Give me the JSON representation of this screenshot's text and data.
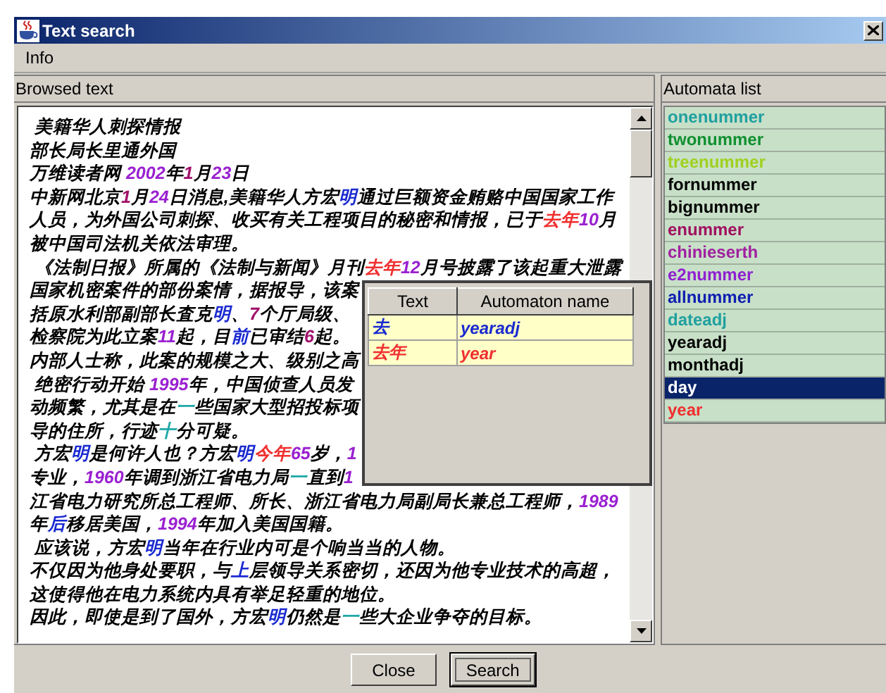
{
  "window": {
    "title": "Text search"
  },
  "menu": [
    "Info"
  ],
  "browsed_text": {
    "label": "Browsed text",
    "lines": [
      [
        {
          "text": " 美籍华人刺探情报"
        }
      ],
      [
        {
          "text": "部长局长里通外国"
        }
      ],
      [
        {
          "text": "万维读者网 "
        },
        {
          "text": "2002",
          "color": "#9a20d0"
        },
        {
          "text": "年"
        },
        {
          "text": "1",
          "color": "#a0106a"
        },
        {
          "text": "月"
        },
        {
          "text": "23",
          "color": "#9a20d0"
        },
        {
          "text": "日"
        }
      ],
      [
        {
          "text": "中新网北京"
        },
        {
          "text": "1",
          "color": "#a0106a"
        },
        {
          "text": "月"
        },
        {
          "text": "24",
          "color": "#9a20d0"
        },
        {
          "text": "日消息,美籍华人方宏"
        },
        {
          "text": "明",
          "color": "#1a2ad0"
        },
        {
          "text": "通过巨额资金贿赂中国国家工作"
        }
      ],
      [
        {
          "text": "人员，为外国公司刺探、收买有关工程项目的秘密和情报，已于"
        },
        {
          "text": "去年",
          "color": "#f03030"
        },
        {
          "text": "10",
          "color": "#9a20d0"
        },
        {
          "text": "月"
        }
      ],
      [
        {
          "text": "被中国司法机关依法审理。"
        }
      ],
      [
        {
          "text": " 《法制日报》所属的《法制与新闻》月刊"
        },
        {
          "text": "去年",
          "color": "#f03030"
        },
        {
          "text": "12",
          "color": "#9a20d0"
        },
        {
          "text": "月号披露了该起重大泄露"
        }
      ],
      [
        {
          "text": "国家机密案件的部份案情，据报导，该案"
        }
      ],
      [
        {
          "text": "括原水利部副部长査克"
        },
        {
          "text": "明",
          "color": "#1a2ad0"
        },
        {
          "text": "、"
        },
        {
          "text": "7",
          "color": "#a0106a"
        },
        {
          "text": "个厅局级、"
        }
      ],
      [
        {
          "text": "检察院为此立案"
        },
        {
          "text": "11",
          "color": "#9a20d0"
        },
        {
          "text": "起，目"
        },
        {
          "text": "前",
          "color": "#1a2ad0"
        },
        {
          "text": "已审结"
        },
        {
          "text": "6",
          "color": "#a0106a"
        },
        {
          "text": "起。"
        }
      ],
      [
        {
          "text": "内部人士称，此案的规模之大、级别之高"
        }
      ],
      [
        {
          "text": " 绝密行动开始 "
        },
        {
          "text": "1995",
          "color": "#9a20d0"
        },
        {
          "text": "年，中国侦查人员发"
        }
      ],
      [
        {
          "text": "动频繁，尤其是在"
        },
        {
          "text": "一",
          "color": "#20a8a8"
        },
        {
          "text": "些国家大型招投标项"
        }
      ],
      [
        {
          "text": "导的住所，行迹"
        },
        {
          "text": "十",
          "color": "#20a8a8"
        },
        {
          "text": "分可疑。"
        }
      ],
      [
        {
          "text": " 方宏"
        },
        {
          "text": "明",
          "color": "#1a2ad0"
        },
        {
          "text": "是何许人也？方宏"
        },
        {
          "text": "明",
          "color": "#1a2ad0"
        },
        {
          "text": "今年",
          "color": "#f03030"
        },
        {
          "text": "65",
          "color": "#9a20d0"
        },
        {
          "text": "岁，"
        },
        {
          "text": "1",
          "color": "#9a20d0"
        }
      ],
      [
        {
          "text": "专业，"
        },
        {
          "text": "1960",
          "color": "#9a20d0"
        },
        {
          "text": "年调到浙江省电力局"
        },
        {
          "text": "一",
          "color": "#20a8a8"
        },
        {
          "text": "直到"
        },
        {
          "text": "1",
          "color": "#9a20d0"
        }
      ],
      [
        {
          "text": "江省电力研究所总工程师、所长、浙江省电力局副局长兼总工程师，"
        },
        {
          "text": "1989",
          "color": "#9a20d0"
        }
      ],
      [
        {
          "text": "年"
        },
        {
          "text": "后",
          "color": "#1a2ad0"
        },
        {
          "text": "移居美国，"
        },
        {
          "text": "1994",
          "color": "#9a20d0"
        },
        {
          "text": "年加入美国国籍。"
        }
      ],
      [
        {
          "text": " 应该说，方宏"
        },
        {
          "text": "明",
          "color": "#1a2ad0"
        },
        {
          "text": "当年在行业内可是个响当当的人物。"
        }
      ],
      [
        {
          "text": "不仅因为他身处要职，与"
        },
        {
          "text": "上",
          "color": "#1a2ad0"
        },
        {
          "text": "层领导关系密切，还因为他专业技术的高超，"
        }
      ],
      [
        {
          "text": "这使得他在电力系统内具有举足轻重的地位。"
        }
      ],
      [
        {
          "text": "因此，即使是到了国外，方宏"
        },
        {
          "text": "明",
          "color": "#1a2ad0"
        },
        {
          "text": "仍然是"
        },
        {
          "text": "一",
          "color": "#20a8a8"
        },
        {
          "text": "些大企业争夺的目标。"
        }
      ]
    ]
  },
  "matches": {
    "columns": [
      "Text",
      "Automaton name"
    ],
    "rows": [
      {
        "text": "去",
        "automaton": "yearadj",
        "color": "#1a2ad0"
      },
      {
        "text": "去年",
        "automaton": "year",
        "color": "#f03030"
      }
    ]
  },
  "automata": {
    "label": "Automata list",
    "items": [
      {
        "name": "onenummer",
        "color": "#20a0a0",
        "selected": false
      },
      {
        "name": "twonummer",
        "color": "#109030",
        "selected": false
      },
      {
        "name": "treenummer",
        "color": "#a0d020",
        "selected": false
      },
      {
        "name": "fornummer",
        "color": "#000000",
        "selected": false
      },
      {
        "name": "bignummer",
        "color": "#000000",
        "selected": false
      },
      {
        "name": "enummer",
        "color": "#a01060",
        "selected": false
      },
      {
        "name": "chinieserth",
        "color": "#a020a0",
        "selected": false
      },
      {
        "name": "e2nummer",
        "color": "#9020d0",
        "selected": false
      },
      {
        "name": "allnummer",
        "color": "#1020b0",
        "selected": false
      },
      {
        "name": "dateadj",
        "color": "#20a0a0",
        "selected": false
      },
      {
        "name": "yearadj",
        "color": "#000000",
        "selected": false
      },
      {
        "name": "monthadj",
        "color": "#000000",
        "selected": false
      },
      {
        "name": "day",
        "selected": true
      },
      {
        "name": "year",
        "color": "#f03030",
        "selected": false
      }
    ]
  },
  "buttons": [
    {
      "label": "Close",
      "default": false
    },
    {
      "label": "Search",
      "default": true
    }
  ]
}
